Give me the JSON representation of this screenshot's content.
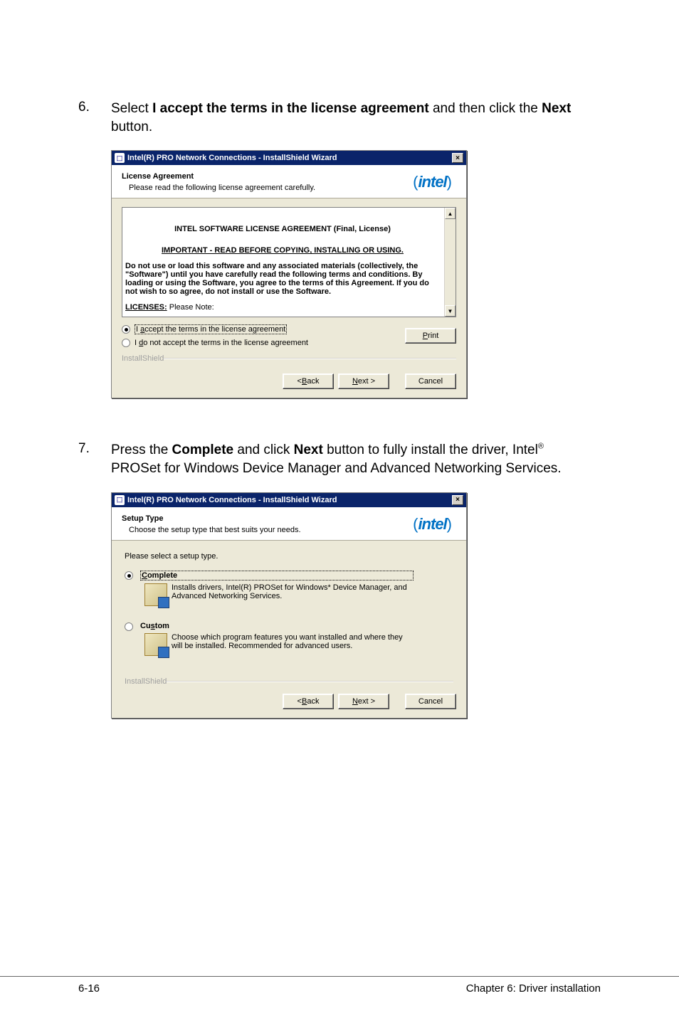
{
  "steps": {
    "s6": {
      "num": "6.",
      "pre": "Select ",
      "bold1": "I accept the terms in the license agreement",
      "mid": " and then click the ",
      "bold2": "Next",
      "post": " button."
    },
    "s7": {
      "num": "7.",
      "pre": "Press the ",
      "bold1": "Complete",
      "mid1": " and click ",
      "bold2": "Next",
      "mid2": " button to fully install the driver, Intel",
      "sup": "®",
      "line2": "PROSet for Windows Device Manager and Advanced Networking Services."
    }
  },
  "dialog1": {
    "title": "Intel(R) PRO Network Connections - InstallShield Wizard",
    "close": "×",
    "header_title": "License Agreement",
    "header_sub": "Please read the following license agreement carefully.",
    "logo": "intel",
    "license": {
      "title": "INTEL SOFTWARE LICENSE AGREEMENT (Final, License)",
      "important": "IMPORTANT - READ BEFORE COPYING, INSTALLING OR USING.",
      "body": "Do not use or load this software and any associated materials (collectively, the \"Software\") until you have carefully read the following terms and conditions. By loading or using the Software, you agree to the terms of this Agreement. If you do not wish to so agree, do not install or use the Software.",
      "licenses_label": "LICENSES:",
      "licenses_rest": " Please Note:"
    },
    "scroll_up": "▲",
    "scroll_down": "▼",
    "radio_accept_pre": "I ",
    "radio_accept_u": "a",
    "radio_accept_post": "ccept the terms in the license agreement",
    "radio_decline_pre": "I ",
    "radio_decline_u": "d",
    "radio_decline_post": "o not accept the terms in the license agreement",
    "print_u": "P",
    "print_rest": "rint",
    "installshield": "InstallShield",
    "back_pre": "< ",
    "back_u": "B",
    "back_post": "ack",
    "next_u": "N",
    "next_post": "ext >",
    "cancel": "Cancel"
  },
  "dialog2": {
    "title": "Intel(R) PRO Network Connections - InstallShield Wizard",
    "close": "×",
    "header_title": "Setup Type",
    "header_sub": "Choose the setup type that best suits your needs.",
    "logo": "intel",
    "prompt": "Please select a setup type.",
    "complete_u": "C",
    "complete_rest": "omplete",
    "complete_desc": "Installs drivers, Intel(R) PROSet for Windows* Device Manager, and Advanced Networking Services.",
    "custom_pre": "Cu",
    "custom_u": "s",
    "custom_rest": "tom",
    "custom_desc": "Choose which program features you want installed and where they will be installed. Recommended for advanced users.",
    "installshield": "InstallShield",
    "back_pre": "< ",
    "back_u": "B",
    "back_post": "ack",
    "next_u": "N",
    "next_post": "ext >",
    "cancel": "Cancel"
  },
  "footer": {
    "left": "6-16",
    "right": "Chapter 6: Driver installation"
  }
}
